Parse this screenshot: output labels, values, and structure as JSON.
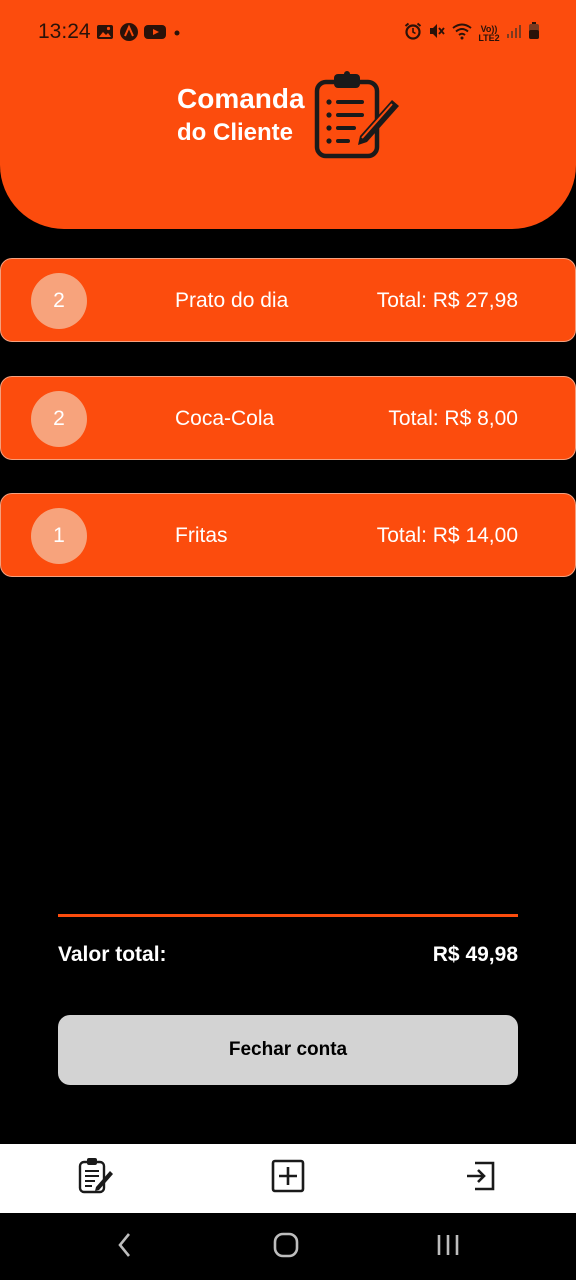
{
  "status_bar": {
    "time": "13:24",
    "network_label": "Vo)) LTE2"
  },
  "header": {
    "title_line1": "Comanda",
    "title_line2": "do Cliente",
    "icon": "clipboard-pen-icon"
  },
  "order_items": [
    {
      "quantity": "2",
      "name": "Prato do dia",
      "total": "Total: R$ 27,98"
    },
    {
      "quantity": "2",
      "name": "Coca-Cola",
      "total": "Total: R$ 8,00"
    },
    {
      "quantity": "1",
      "name": "Fritas",
      "total": "Total: R$ 14,00"
    }
  ],
  "summary": {
    "label": "Valor total:",
    "value": "R$ 49,98"
  },
  "close_button_label": "Fechar conta",
  "tab_bar": {
    "tabs": [
      {
        "icon": "clipboard-edit-icon"
      },
      {
        "icon": "plus-square-icon"
      },
      {
        "icon": "logout-icon"
      }
    ]
  },
  "colors": {
    "accent": "#FC4C0D",
    "badge": "#F7A37C",
    "background": "#000000",
    "button": "#D3D3D3"
  }
}
